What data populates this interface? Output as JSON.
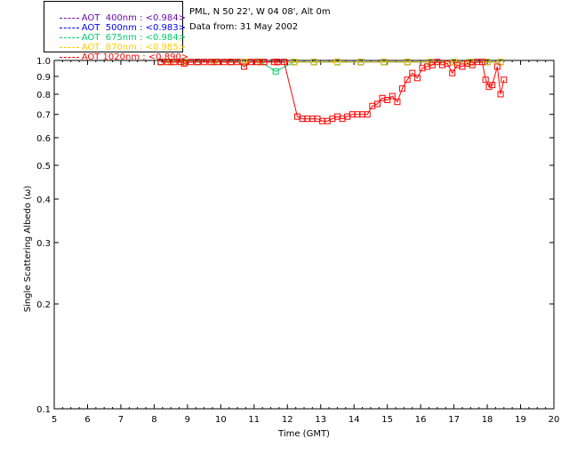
{
  "info": {
    "location": "PML, N 50 22', W 04 08', Alt 0m",
    "date": "Data from: 31 May 2002"
  },
  "legend": [
    {
      "label": "AOT  400nm : <0.984>",
      "color": "#6a0dad"
    },
    {
      "label": "AOT  500nm : <0.983>",
      "color": "#0000ff"
    },
    {
      "label": "AOT  675nm : <0.984>",
      "color": "#00cc66"
    },
    {
      "label": "AOT  870nm : <0.985>",
      "color": "#ffcc00"
    },
    {
      "label": "AOT 1020nm : <0.890>",
      "color": "#ff0000"
    }
  ],
  "chart_data": {
    "type": "line",
    "xlabel": "Time (GMT)",
    "ylabel": "Single Scattering Albedo (ω)",
    "xlim": [
      5,
      20
    ],
    "ylim": [
      0.1,
      1.0
    ],
    "yscale": "log",
    "xticks": [
      "5",
      "6",
      "7",
      "8",
      "9",
      "10",
      "11",
      "12",
      "13",
      "14",
      "15",
      "16",
      "17",
      "18",
      "19",
      "20"
    ],
    "yticks": [
      {
        "value": 1.0,
        "label": "1.0"
      },
      {
        "value": 0.9,
        "label": "0.9"
      },
      {
        "value": 0.8,
        "label": "0.8"
      },
      {
        "value": 0.7,
        "label": "0.7"
      },
      {
        "value": 0.6,
        "label": "0.6"
      },
      {
        "value": 0.5,
        "label": "0.5"
      },
      {
        "value": 0.4,
        "label": "0.4"
      },
      {
        "value": 0.3,
        "label": "0.3"
      },
      {
        "value": 0.2,
        "label": "0.2"
      },
      {
        "value": 0.1,
        "label": "0.1"
      }
    ],
    "series": [
      {
        "name": "AOT  400nm : <0.984>",
        "color": "#6a0dad",
        "x": [
          8.2,
          8.5,
          8.9,
          9.3,
          9.8,
          10.3,
          10.7,
          11.2,
          11.7,
          12.2,
          12.8,
          13.5,
          14.2,
          14.9,
          15.6,
          16.3,
          17.0,
          17.5,
          18.0,
          18.4
        ],
        "y": [
          0.99,
          0.99,
          0.99,
          0.99,
          0.99,
          0.99,
          0.99,
          0.99,
          0.99,
          0.99,
          0.99,
          0.99,
          0.99,
          0.99,
          0.99,
          0.99,
          0.99,
          0.99,
          0.99,
          0.99
        ]
      },
      {
        "name": "AOT  500nm : <0.983>",
        "color": "#0000ff",
        "x": [
          8.2,
          8.5,
          8.9,
          9.3,
          9.8,
          10.3,
          10.7,
          11.2,
          11.7,
          12.2,
          12.8,
          13.5,
          14.2,
          14.9,
          15.6,
          16.3,
          17.0,
          17.5,
          18.0,
          18.4
        ],
        "y": [
          0.99,
          0.99,
          0.99,
          0.99,
          0.99,
          0.99,
          0.99,
          0.99,
          0.99,
          0.99,
          0.99,
          0.99,
          0.99,
          0.99,
          0.99,
          0.99,
          0.99,
          0.99,
          0.99,
          0.99
        ]
      },
      {
        "name": "AOT  675nm : <0.984>",
        "color": "#00cc66",
        "x": [
          8.2,
          8.5,
          8.9,
          9.3,
          9.8,
          10.3,
          10.7,
          11.2,
          11.65,
          12.2,
          12.8,
          13.5,
          14.2,
          14.9,
          15.6,
          16.3,
          17.0,
          17.5,
          18.0,
          18.4
        ],
        "y": [
          0.99,
          0.99,
          0.99,
          0.99,
          0.99,
          0.99,
          0.99,
          0.99,
          0.93,
          0.99,
          0.99,
          0.99,
          0.99,
          0.99,
          0.99,
          0.99,
          0.99,
          0.99,
          0.99,
          0.99
        ]
      },
      {
        "name": "AOT  870nm : <0.985>",
        "color": "#ffcc00",
        "x": [
          8.2,
          8.5,
          8.9,
          9.3,
          9.8,
          10.3,
          10.7,
          11.2,
          11.7,
          12.2,
          12.8,
          13.5,
          14.2,
          14.9,
          15.6,
          16.3,
          17.0,
          17.5,
          18.0,
          18.4
        ],
        "y": [
          0.99,
          0.99,
          0.99,
          0.99,
          0.99,
          0.99,
          0.99,
          0.99,
          0.99,
          0.99,
          0.99,
          0.99,
          0.99,
          0.99,
          0.99,
          0.99,
          0.99,
          0.99,
          0.99,
          0.99
        ]
      },
      {
        "name": "AOT 1020nm : <0.890>",
        "color": "#ff0000",
        "x": [
          8.2,
          8.4,
          8.6,
          8.8,
          8.9,
          9.1,
          9.3,
          9.5,
          9.7,
          9.9,
          10.1,
          10.3,
          10.5,
          10.7,
          10.9,
          11.1,
          11.3,
          11.6,
          11.7,
          11.9,
          12.3,
          12.45,
          12.6,
          12.75,
          12.9,
          13.05,
          13.2,
          13.35,
          13.5,
          13.65,
          13.8,
          13.95,
          14.1,
          14.25,
          14.4,
          14.55,
          14.7,
          14.85,
          15.0,
          15.15,
          15.3,
          15.45,
          15.6,
          15.75,
          15.9,
          16.05,
          16.2,
          16.35,
          16.5,
          16.65,
          16.8,
          16.95,
          17.1,
          17.25,
          17.4,
          17.55,
          17.7,
          17.85,
          17.95,
          18.05,
          18.15,
          18.3,
          18.4,
          18.5
        ],
        "y": [
          0.99,
          0.99,
          0.99,
          0.99,
          0.98,
          0.99,
          0.99,
          0.99,
          0.99,
          0.99,
          0.99,
          0.99,
          0.99,
          0.96,
          0.99,
          0.99,
          0.99,
          0.99,
          0.99,
          0.99,
          0.69,
          0.68,
          0.68,
          0.68,
          0.68,
          0.67,
          0.67,
          0.68,
          0.69,
          0.68,
          0.69,
          0.7,
          0.7,
          0.7,
          0.7,
          0.74,
          0.75,
          0.78,
          0.77,
          0.79,
          0.76,
          0.83,
          0.88,
          0.92,
          0.89,
          0.95,
          0.96,
          0.97,
          0.99,
          0.97,
          0.98,
          0.92,
          0.97,
          0.96,
          0.98,
          0.97,
          0.99,
          0.99,
          0.88,
          0.84,
          0.85,
          0.96,
          0.8,
          0.88
        ]
      }
    ]
  }
}
